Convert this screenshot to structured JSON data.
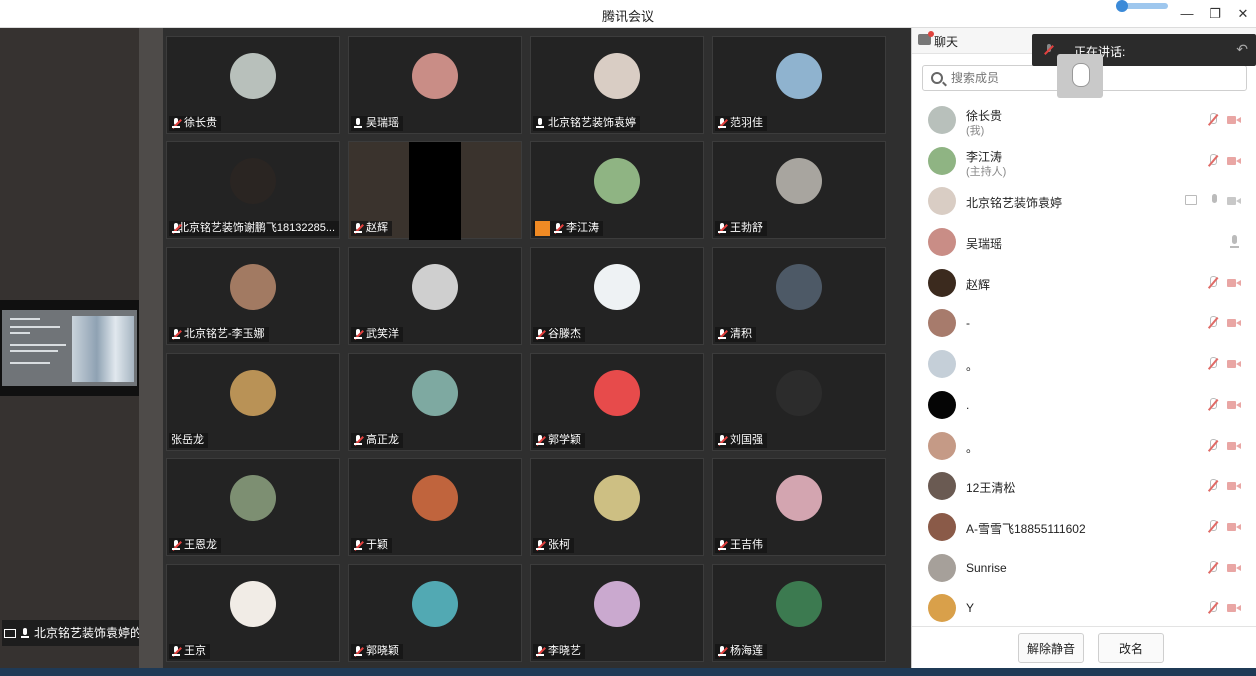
{
  "window": {
    "title": "腾讯会议",
    "minimize_icon": "minimize-icon",
    "restore_icon": "restore-icon",
    "close_icon": "close-icon"
  },
  "left_panel": {
    "bottom_label": "北京铭艺装饰袁婷的"
  },
  "grid": {
    "tiles": [
      {
        "name": "徐长贵",
        "mic": "muted",
        "avatar": "#b8c0bb"
      },
      {
        "name": "吴瑞瑶",
        "mic": "on",
        "avatar": "#c98d86"
      },
      {
        "name": "北京铭艺装饰袁婷",
        "mic": "on",
        "avatar": "#d9cdc4"
      },
      {
        "name": "范羽佳",
        "mic": "muted",
        "avatar": "#8fb3cf"
      },
      {
        "name": "北京铭艺装饰谢鹏飞18132285...",
        "mic": "muted",
        "avatar": "#2a2522"
      },
      {
        "name": "赵辉",
        "mic": "muted",
        "avatar": "video"
      },
      {
        "name": "李江涛",
        "mic": "muted",
        "avatar": "#8fb483",
        "host_badge": true
      },
      {
        "name": "王勃舒",
        "mic": "muted",
        "avatar": "#a8a59f"
      },
      {
        "name": "北京铭艺-李玉娜",
        "mic": "muted",
        "avatar": "#a27a62"
      },
      {
        "name": "武笑洋",
        "mic": "muted",
        "avatar": "#cfcfcf"
      },
      {
        "name": "谷滕杰",
        "mic": "muted",
        "avatar": "#eef2f4"
      },
      {
        "name": "清积",
        "mic": "muted",
        "avatar": "#4d5966"
      },
      {
        "name": "张岳龙",
        "mic": "none",
        "avatar": "#b99256"
      },
      {
        "name": "高正龙",
        "mic": "muted",
        "avatar": "#7ea9a1"
      },
      {
        "name": "郭学颖",
        "mic": "muted",
        "avatar": "#e74b4b"
      },
      {
        "name": "刘国强",
        "mic": "muted",
        "avatar": "#2c2c2c"
      },
      {
        "name": "王恩龙",
        "mic": "muted",
        "avatar": "#7d8f72"
      },
      {
        "name": "于颖",
        "mic": "muted",
        "avatar": "#c0643d"
      },
      {
        "name": "张柯",
        "mic": "muted",
        "avatar": "#cdbf83"
      },
      {
        "name": "王吉伟",
        "mic": "muted",
        "avatar": "#d3a5b0"
      },
      {
        "name": "王京",
        "mic": "muted",
        "avatar": "#f1ece6"
      },
      {
        "name": "郭晓颖",
        "mic": "muted",
        "avatar": "#52a9b3"
      },
      {
        "name": "李晓艺",
        "mic": "muted",
        "avatar": "#caa9cf"
      },
      {
        "name": "杨海莲",
        "mic": "muted",
        "avatar": "#3c7a50"
      }
    ]
  },
  "chat": {
    "tab_label": "聊天",
    "speaking_label": "正在讲话:",
    "search_placeholder": "搜索成员",
    "members": [
      {
        "name": "徐长贵",
        "sub": "(我)",
        "avatar": "#b8c0bb",
        "icons": "muted"
      },
      {
        "name": "李江涛",
        "sub": "(主持人)",
        "avatar": "#8fb483",
        "icons": "muted"
      },
      {
        "name": "北京铭艺装饰袁婷",
        "sub": "",
        "avatar": "#d9cdc4",
        "icons": "screen"
      },
      {
        "name": "吴瑞瑶",
        "sub": "",
        "avatar": "#c98d86",
        "icons": "mic-only"
      },
      {
        "name": "赵辉",
        "sub": "",
        "avatar": "#3b2a1e",
        "icons": "muted"
      },
      {
        "name": "-",
        "sub": "",
        "avatar": "#a77b6c",
        "icons": "muted"
      },
      {
        "name": "。",
        "sub": "",
        "avatar": "#c5cfd8",
        "icons": "muted"
      },
      {
        "name": ".",
        "sub": "",
        "avatar": "#050505",
        "icons": "muted"
      },
      {
        "name": "。",
        "sub": "",
        "avatar": "#c59a86",
        "icons": "muted"
      },
      {
        "name": "12王清松",
        "sub": "",
        "avatar": "#6a5a52",
        "icons": "muted"
      },
      {
        "name": "A-雪雪飞18855111602",
        "sub": "",
        "avatar": "#8a5a48",
        "icons": "muted"
      },
      {
        "name": "Sunrise",
        "sub": "",
        "avatar": "#a6a09a",
        "icons": "muted"
      },
      {
        "name": "Y",
        "sub": "",
        "avatar": "#d9a04a",
        "icons": "muted"
      }
    ],
    "unmute_label": "解除静音",
    "rename_label": "改名"
  }
}
